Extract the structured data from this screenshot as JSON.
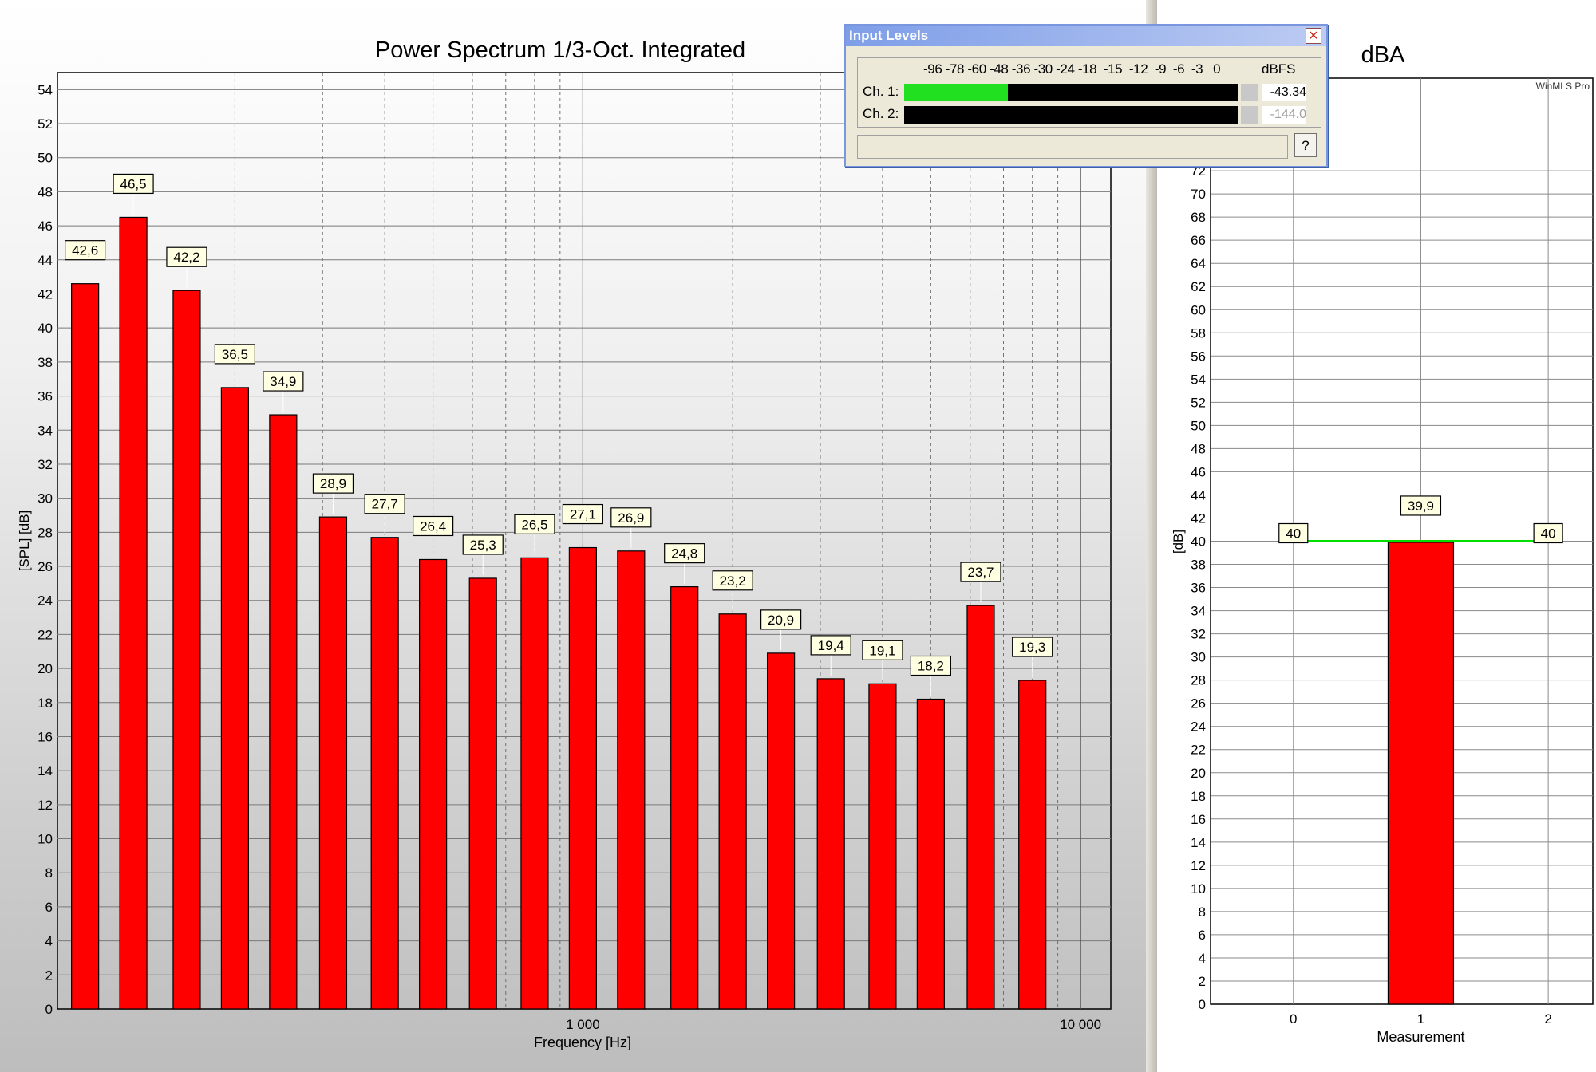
{
  "chart_data": [
    {
      "type": "bar",
      "title": "Power Spectrum 1/3-Oct. Integrated",
      "xlabel": "Frequency [Hz]",
      "ylabel": "[SPL] [dB]",
      "x_scale": "log",
      "x_ticks": [
        "1 000",
        "10 000"
      ],
      "ylim": [
        0,
        55
      ],
      "y_ticks": [
        0,
        2,
        4,
        6,
        8,
        10,
        12,
        14,
        16,
        18,
        20,
        22,
        24,
        26,
        28,
        30,
        32,
        34,
        36,
        38,
        40,
        42,
        44,
        46,
        48,
        50,
        52,
        54
      ],
      "grid": true,
      "bar_color": "#ff0000",
      "x_hz": [
        100,
        125,
        160,
        200,
        250,
        315,
        400,
        500,
        630,
        800,
        1000,
        1250,
        1600,
        2000,
        2500,
        3150,
        4000,
        5000,
        6300,
        8000,
        10000
      ],
      "values": [
        42.6,
        46.5,
        42.2,
        36.5,
        34.9,
        28.9,
        27.7,
        26.4,
        25.3,
        26.5,
        27.1,
        26.9,
        24.8,
        23.2,
        20.9,
        19.4,
        19.1,
        18.2,
        23.7,
        19.3
      ],
      "data_labels": [
        "42,6",
        "46,5",
        "42,2",
        "36,5",
        "34,9",
        "28,9",
        "27,7",
        "26,4",
        "25,3",
        "26,5",
        "27,1",
        "26,9",
        "24,8",
        "23,2",
        "20,9",
        "19,4",
        "19,1",
        "18,2",
        "23,7",
        "19,3"
      ]
    },
    {
      "type": "bar",
      "title": "dBA",
      "xlabel": "Measurement",
      "ylabel": "[dB]",
      "watermark": "WinMLS Pro",
      "x_ticks": [
        "0",
        "1",
        "2"
      ],
      "ylim": [
        0,
        80
      ],
      "y_ticks": [
        0,
        2,
        4,
        6,
        8,
        10,
        12,
        14,
        16,
        18,
        20,
        22,
        24,
        26,
        28,
        30,
        32,
        34,
        36,
        38,
        40,
        42,
        44,
        46,
        48,
        50,
        52,
        54,
        56,
        58,
        60,
        62,
        64,
        66,
        68,
        70,
        72
      ],
      "grid": true,
      "bar_color": "#ff0000",
      "bars": [
        {
          "x": 1,
          "value": 39.9,
          "label": "39,9"
        }
      ],
      "reference_line": {
        "value": 40,
        "color": "#00e000",
        "labels": [
          "40",
          "40"
        ]
      }
    }
  ],
  "input_levels": {
    "title": "Input Levels",
    "close_icon": "close-icon",
    "scale_ticks": "-96 -78 -60 -48 -36 -30 -24 -18  -15  -12  -9  -6  -3   0",
    "unit": "dBFS",
    "channels": [
      {
        "label": "Ch. 1:",
        "value": "-43.34",
        "level_fraction": 0.31,
        "color": "#20e020"
      },
      {
        "label": "Ch. 2:",
        "value": "-144.0",
        "level_fraction": 0.0,
        "color": "#20e020"
      }
    ],
    "help_label": "?"
  }
}
